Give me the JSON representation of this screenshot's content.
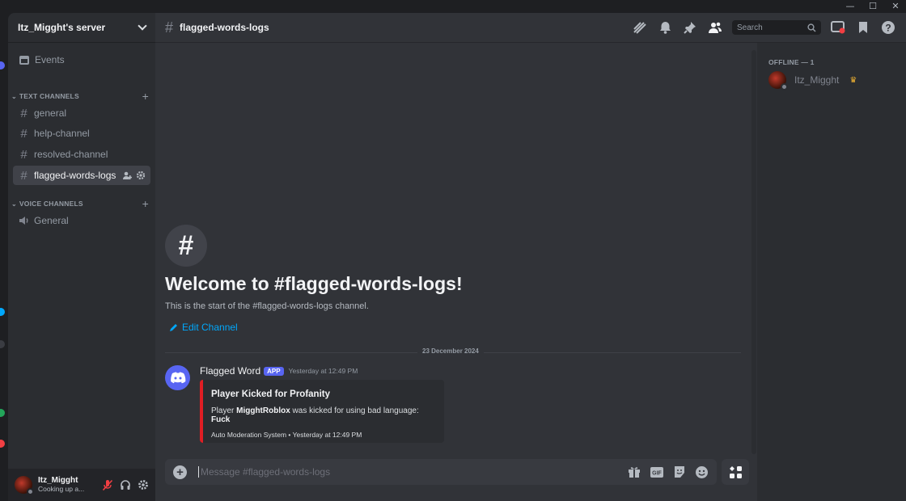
{
  "window": {
    "minimize": "—",
    "maximize": "☐",
    "close": "✕"
  },
  "server": {
    "name": "Itz_Migght's server"
  },
  "sidebar": {
    "events_label": "Events",
    "text_category": "TEXT CHANNELS",
    "voice_category": "VOICE CHANNELS",
    "text_channels": [
      {
        "name": "general"
      },
      {
        "name": "help-channel"
      },
      {
        "name": "resolved-channel"
      },
      {
        "name": "flagged-words-logs"
      }
    ],
    "voice_channels": [
      {
        "name": "General"
      }
    ]
  },
  "user": {
    "name": "Itz_Migght",
    "status": "Cooking up a..."
  },
  "channel": {
    "title": "flagged-words-logs"
  },
  "search": {
    "placeholder": "Search"
  },
  "welcome": {
    "title": "Welcome to #flagged-words-logs!",
    "subtitle": "This is the start of the #flagged-words-logs channel.",
    "edit_label": "Edit Channel"
  },
  "divider": {
    "date": "23 December 2024"
  },
  "message": {
    "author": "Flagged Word",
    "badge": "APP",
    "time": "Yesterday at 12:49 PM",
    "embed": {
      "title": "Player Kicked for Profanity",
      "desc_prefix": "Player ",
      "player": "MigghtRoblox",
      "desc_middle": " was kicked for using bad language: ",
      "word": "Fuck",
      "footer": "Auto Moderation System • Yesterday at 12:49 PM",
      "color": "#e01e24"
    }
  },
  "composer": {
    "placeholder": "Message #flagged-words-logs"
  },
  "members": {
    "offline_header": "OFFLINE — 1",
    "list": [
      {
        "name": "Itz_Migght",
        "owner_icon": "crown-icon"
      }
    ]
  },
  "colors": {
    "accent": "#5865f2",
    "link": "#00a8fc",
    "status_offline": "#80848e"
  }
}
